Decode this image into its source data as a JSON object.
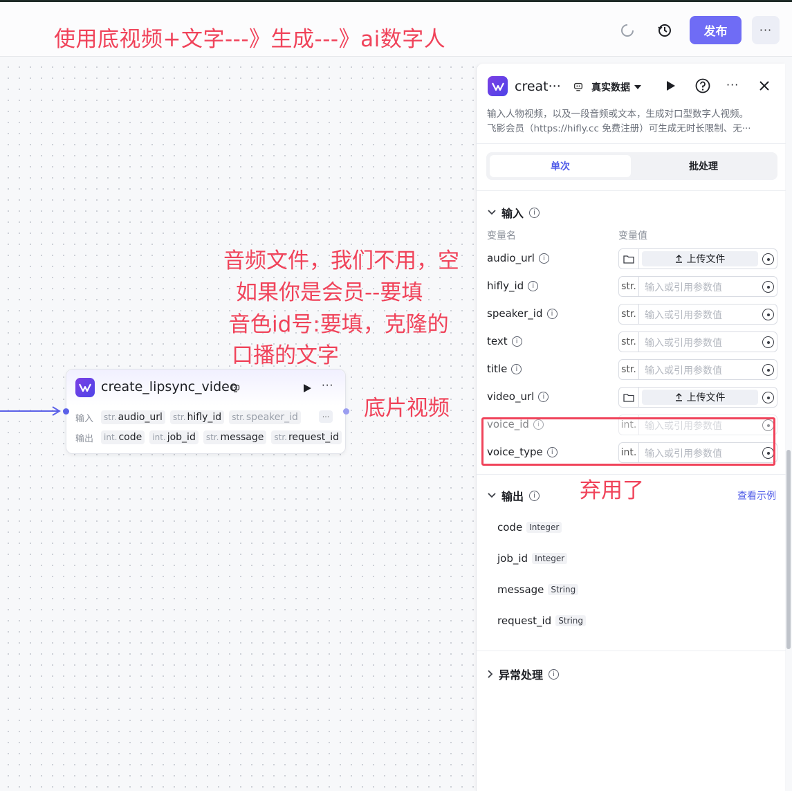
{
  "header": {
    "annotation_title": "使用底视频+文字---》生成---》ai数字人",
    "publish_label": "发布",
    "more_label": "···"
  },
  "canvas": {
    "annotations": {
      "audio": "音频文件，我们不用，空",
      "member": "如果你是会员--要填",
      "speaker": "音色id号:要填，克隆的",
      "text": "口播的文字",
      "video": "底片视频",
      "deprecated": "弃用了"
    },
    "node": {
      "title": "create_lipsync_video",
      "input_label": "输入",
      "output_label": "输出",
      "inputs": [
        {
          "type": "str.",
          "name": "audio_url"
        },
        {
          "type": "str.",
          "name": "hifly_id"
        },
        {
          "type": "str.",
          "name": "speaker_id"
        }
      ],
      "outputs": [
        {
          "type": "int.",
          "name": "code"
        },
        {
          "type": "int.",
          "name": "job_id"
        },
        {
          "type": "str.",
          "name": "message"
        },
        {
          "type": "str.",
          "name": "request_id"
        }
      ],
      "more_label": "···"
    }
  },
  "panel": {
    "title": "creat···",
    "mode": "真实数据",
    "description_line1": "输入人物视频，以及一段音频或文本，生成对口型数字人视频。",
    "description_line2": "飞影会员（https://hifly.cc 免费注册）可生成无时长限制、无···",
    "tabs": [
      "单次",
      "批处理"
    ],
    "input_section": "输入",
    "col_name": "变量名",
    "col_value": "变量值",
    "params": [
      {
        "name": "audio_url",
        "kind": "upload",
        "label": "上传文件"
      },
      {
        "name": "hifly_id",
        "kind": "str.",
        "placeholder": "输入或引用参数值"
      },
      {
        "name": "speaker_id",
        "kind": "str.",
        "placeholder": "输入或引用参数值"
      },
      {
        "name": "text",
        "kind": "str.",
        "placeholder": "输入或引用参数值"
      },
      {
        "name": "title",
        "kind": "str.",
        "placeholder": "输入或引用参数值"
      },
      {
        "name": "video_url",
        "kind": "upload",
        "label": "上传文件"
      },
      {
        "name": "voice_id",
        "kind": "int.",
        "placeholder": "输入或引用参数值"
      },
      {
        "name": "voice_type",
        "kind": "int.",
        "placeholder": "输入或引用参数值"
      }
    ],
    "output_section": "输出",
    "view_example": "查看示例",
    "outputs": [
      {
        "name": "code",
        "type": "Integer"
      },
      {
        "name": "job_id",
        "type": "Integer"
      },
      {
        "name": "message",
        "type": "String"
      },
      {
        "name": "request_id",
        "type": "String"
      }
    ],
    "error_section": "异常处理",
    "more_label": "···"
  },
  "colors": {
    "accent": "#6f6cf5",
    "annotation": "#f0435a",
    "connector": "#5b61e8"
  }
}
